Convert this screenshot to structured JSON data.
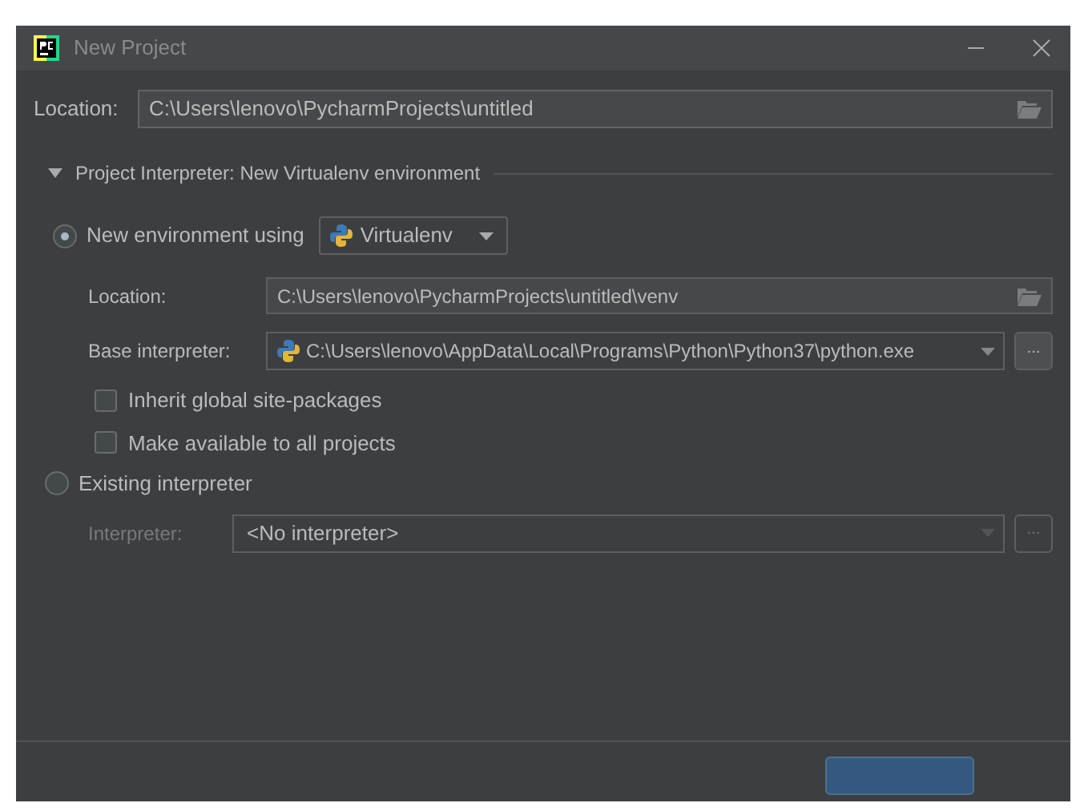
{
  "window": {
    "title": "New Project"
  },
  "location": {
    "label": "Location:",
    "value": "C:\\Users\\lenovo\\PycharmProjects\\untitled"
  },
  "section": {
    "title": "Project Interpreter: New Virtualenv environment",
    "expanded": true
  },
  "options": [
    {
      "kind": "new",
      "label": "New environment using",
      "selected": true,
      "tool": "Virtualenv",
      "location_label": "Location:",
      "location_value": "C:\\Users\\lenovo\\PycharmProjects\\untitled\\venv",
      "base_label": "Base interpreter:",
      "base_value": "C:\\Users\\lenovo\\AppData\\Local\\Programs\\Python\\Python37\\python.exe",
      "browse": "...",
      "checkboxes": [
        {
          "label": "Inherit global site-packages",
          "checked": false
        },
        {
          "label": "Make available to all projects",
          "checked": false
        }
      ]
    },
    {
      "kind": "existing",
      "label": "Existing interpreter",
      "selected": false,
      "interpreter_label": "Interpreter:",
      "interpreter_value": "<No interpreter>",
      "disabled": true,
      "browse": "..."
    }
  ]
}
